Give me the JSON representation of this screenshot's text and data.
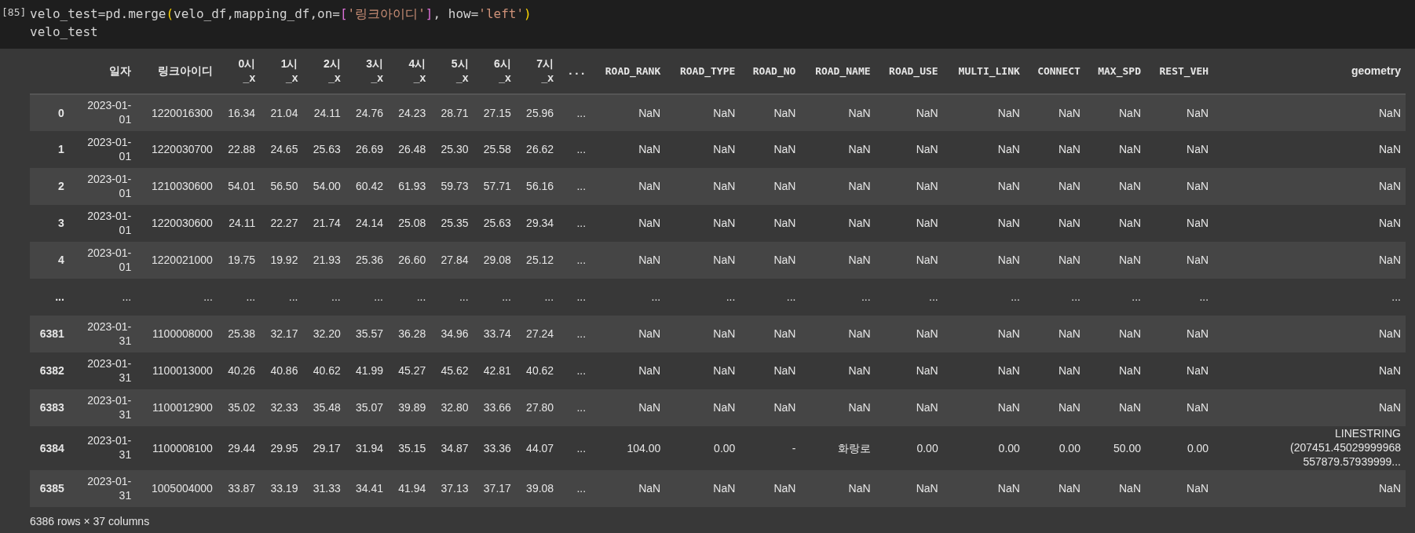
{
  "cell": {
    "execution_count": "[85]",
    "code_lines": [
      [
        {
          "kind": "plain",
          "text": "velo_test=pd.merge"
        },
        {
          "kind": "bracket1",
          "text": "("
        },
        {
          "kind": "plain",
          "text": "velo_df,mapping_df,on="
        },
        {
          "kind": "bracket2",
          "text": "["
        },
        {
          "kind": "string",
          "text": "'링크아이디'"
        },
        {
          "kind": "bracket2",
          "text": "]"
        },
        {
          "kind": "plain",
          "text": ", how="
        },
        {
          "kind": "string",
          "text": "'left'"
        },
        {
          "kind": "bracket1",
          "text": ")"
        }
      ],
      [
        {
          "kind": "plain",
          "text": "velo_test"
        }
      ]
    ]
  },
  "table": {
    "columns": [
      "",
      "일자",
      "링크아이디",
      "0시 _x",
      "1시 _x",
      "2시 _x",
      "3시 _x",
      "4시 _x",
      "5시 _x",
      "6시 _x",
      "7시 _x",
      "...",
      "ROAD_RANK",
      "ROAD_TYPE",
      "ROAD_NO",
      "ROAD_NAME",
      "ROAD_USE",
      "MULTI_LINK",
      "CONNECT",
      "MAX_SPD",
      "REST_VEH",
      "geometry"
    ],
    "rows": [
      [
        "0",
        "2023-01-01",
        "1220016300",
        "16.34",
        "21.04",
        "24.11",
        "24.76",
        "24.23",
        "28.71",
        "27.15",
        "25.96",
        "...",
        "NaN",
        "NaN",
        "NaN",
        "NaN",
        "NaN",
        "NaN",
        "NaN",
        "NaN",
        "NaN",
        "NaN"
      ],
      [
        "1",
        "2023-01-01",
        "1220030700",
        "22.88",
        "24.65",
        "25.63",
        "26.69",
        "26.48",
        "25.30",
        "25.58",
        "26.62",
        "...",
        "NaN",
        "NaN",
        "NaN",
        "NaN",
        "NaN",
        "NaN",
        "NaN",
        "NaN",
        "NaN",
        "NaN"
      ],
      [
        "2",
        "2023-01-01",
        "1210030600",
        "54.01",
        "56.50",
        "54.00",
        "60.42",
        "61.93",
        "59.73",
        "57.71",
        "56.16",
        "...",
        "NaN",
        "NaN",
        "NaN",
        "NaN",
        "NaN",
        "NaN",
        "NaN",
        "NaN",
        "NaN",
        "NaN"
      ],
      [
        "3",
        "2023-01-01",
        "1220030600",
        "24.11",
        "22.27",
        "21.74",
        "24.14",
        "25.08",
        "25.35",
        "25.63",
        "29.34",
        "...",
        "NaN",
        "NaN",
        "NaN",
        "NaN",
        "NaN",
        "NaN",
        "NaN",
        "NaN",
        "NaN",
        "NaN"
      ],
      [
        "4",
        "2023-01-01",
        "1220021000",
        "19.75",
        "19.92",
        "21.93",
        "25.36",
        "26.60",
        "27.84",
        "29.08",
        "25.12",
        "...",
        "NaN",
        "NaN",
        "NaN",
        "NaN",
        "NaN",
        "NaN",
        "NaN",
        "NaN",
        "NaN",
        "NaN"
      ],
      [
        "...",
        "...",
        "...",
        "...",
        "...",
        "...",
        "...",
        "...",
        "...",
        "...",
        "...",
        "...",
        "...",
        "...",
        "...",
        "...",
        "...",
        "...",
        "...",
        "...",
        "...",
        "..."
      ],
      [
        "6381",
        "2023-01-31",
        "1100008000",
        "25.38",
        "32.17",
        "32.20",
        "35.57",
        "36.28",
        "34.96",
        "33.74",
        "27.24",
        "...",
        "NaN",
        "NaN",
        "NaN",
        "NaN",
        "NaN",
        "NaN",
        "NaN",
        "NaN",
        "NaN",
        "NaN"
      ],
      [
        "6382",
        "2023-01-31",
        "1100013000",
        "40.26",
        "40.86",
        "40.62",
        "41.99",
        "45.27",
        "45.62",
        "42.81",
        "40.62",
        "...",
        "NaN",
        "NaN",
        "NaN",
        "NaN",
        "NaN",
        "NaN",
        "NaN",
        "NaN",
        "NaN",
        "NaN"
      ],
      [
        "6383",
        "2023-01-31",
        "1100012900",
        "35.02",
        "32.33",
        "35.48",
        "35.07",
        "39.89",
        "32.80",
        "33.66",
        "27.80",
        "...",
        "NaN",
        "NaN",
        "NaN",
        "NaN",
        "NaN",
        "NaN",
        "NaN",
        "NaN",
        "NaN",
        "NaN"
      ],
      [
        "6384",
        "2023-01-31",
        "1100008100",
        "29.44",
        "29.95",
        "29.17",
        "31.94",
        "35.15",
        "34.87",
        "33.36",
        "44.07",
        "...",
        "104.00",
        "0.00",
        "-",
        "화랑로",
        "0.00",
        "0.00",
        "0.00",
        "50.00",
        "0.00",
        "LINESTRING (207451.45029999968 557879.57939999..."
      ],
      [
        "6385",
        "2023-01-31",
        "1005004000",
        "33.87",
        "33.19",
        "31.33",
        "34.41",
        "41.94",
        "37.13",
        "37.17",
        "39.08",
        "...",
        "NaN",
        "NaN",
        "NaN",
        "NaN",
        "NaN",
        "NaN",
        "NaN",
        "NaN",
        "NaN",
        "NaN"
      ]
    ]
  },
  "footer": "6386 rows × 37 columns"
}
